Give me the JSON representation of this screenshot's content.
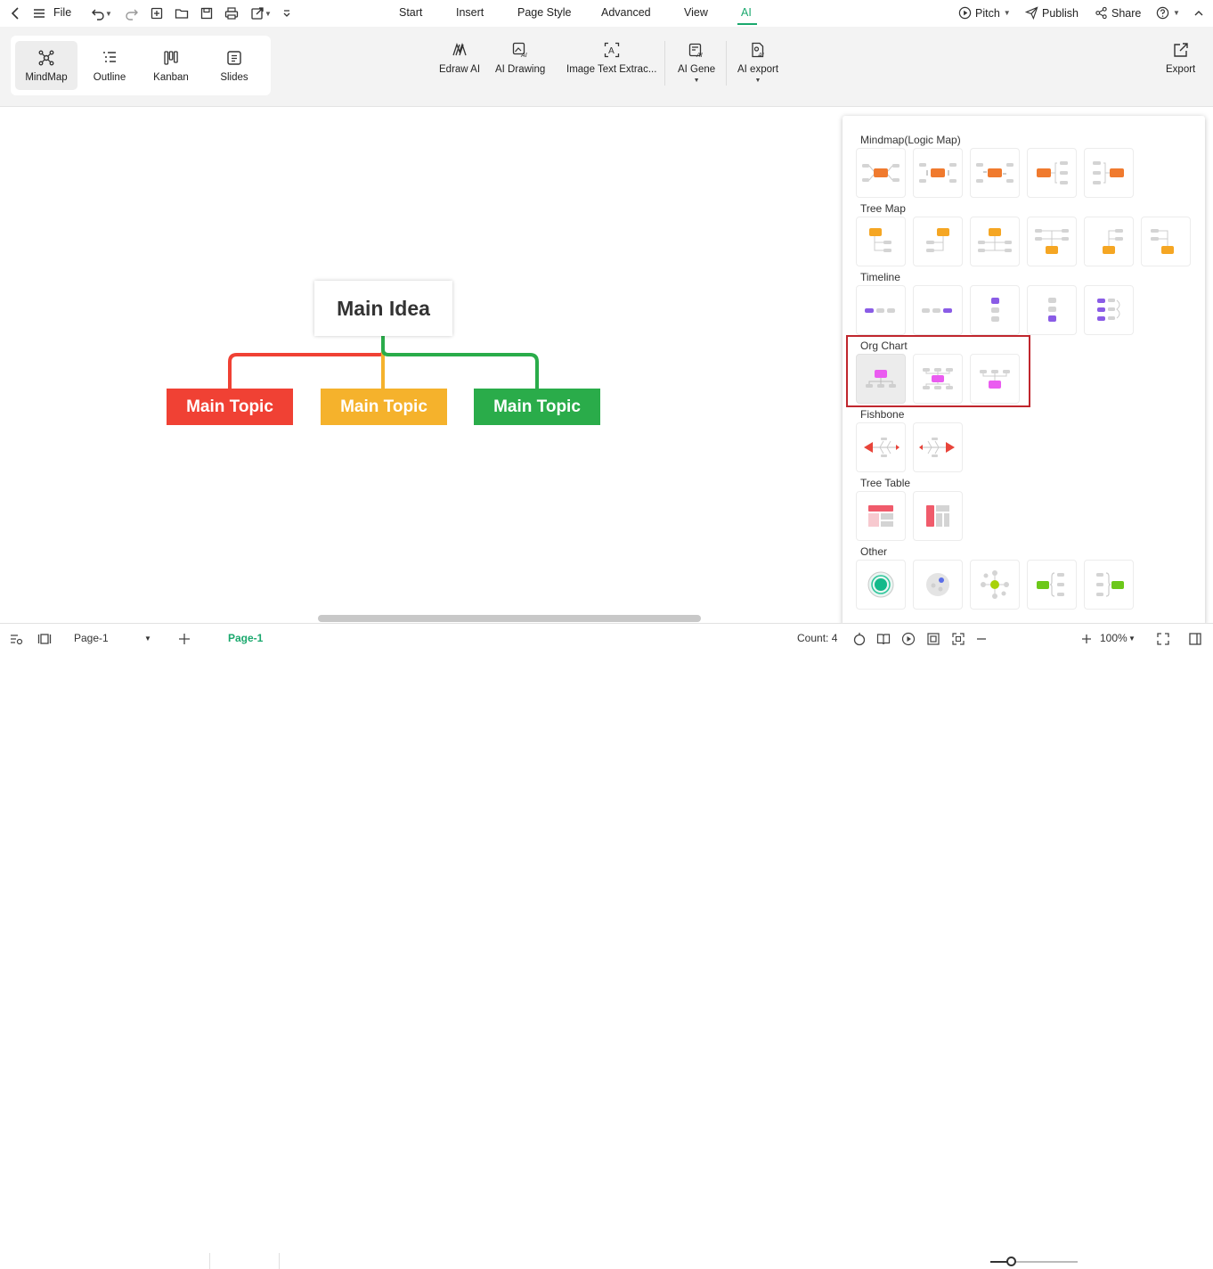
{
  "menubar": {
    "file_label": "File",
    "tabs": [
      "Start",
      "Insert",
      "Page Style",
      "Advanced",
      "View",
      "AI"
    ],
    "active_tab": "AI",
    "pitch_label": "Pitch",
    "publish_label": "Publish",
    "share_label": "Share"
  },
  "ribbon": {
    "views": [
      {
        "label": "MindMap",
        "icon": "mindmap-icon",
        "active": true
      },
      {
        "label": "Outline",
        "icon": "outline-icon",
        "active": false
      },
      {
        "label": "Kanban",
        "icon": "kanban-icon",
        "active": false
      },
      {
        "label": "Slides",
        "icon": "slides-icon",
        "active": false
      }
    ],
    "tools": [
      {
        "label": "Edraw AI",
        "icon": "edraw-ai-icon"
      },
      {
        "label": "AI Drawing",
        "icon": "ai-drawing-icon"
      },
      {
        "label": "Image Text Extrac...",
        "icon": "image-text-extract-icon"
      },
      {
        "label": "AI Gene",
        "icon": "ai-generate-icon"
      },
      {
        "label": "AI export",
        "icon": "ai-export-icon"
      }
    ],
    "export_label": "Export"
  },
  "canvas": {
    "main_idea": "Main Idea",
    "topics": [
      {
        "label": "Main Topic",
        "color": "#f04134"
      },
      {
        "label": "Main Topic",
        "color": "#f5b22c"
      },
      {
        "label": "Main Topic",
        "color": "#2aac4a"
      }
    ]
  },
  "layout_panel": {
    "sections": [
      {
        "title": "Mindmap(Logic Map)",
        "count": 5
      },
      {
        "title": "Tree Map",
        "count": 6
      },
      {
        "title": "Timeline",
        "count": 5
      },
      {
        "title": "Org Chart",
        "count": 3
      },
      {
        "title": "Fishbone",
        "count": 2
      },
      {
        "title": "Tree Table",
        "count": 2
      },
      {
        "title": "Other",
        "count": 5
      }
    ],
    "highlighted_section": "Org Chart",
    "colors": {
      "mindmap": "#f07a2e",
      "treemap": "#f5a623",
      "timeline": "#8a5ce6",
      "orgchart": "#ea5cf0",
      "fishbone": "#e8443a",
      "treetable": "#f05b6b",
      "other": "#6cc81a"
    }
  },
  "statusbar": {
    "page_select": "Page-1",
    "active_page_tab": "Page-1",
    "count_label": "Count: 4",
    "zoom_label": "100%"
  }
}
